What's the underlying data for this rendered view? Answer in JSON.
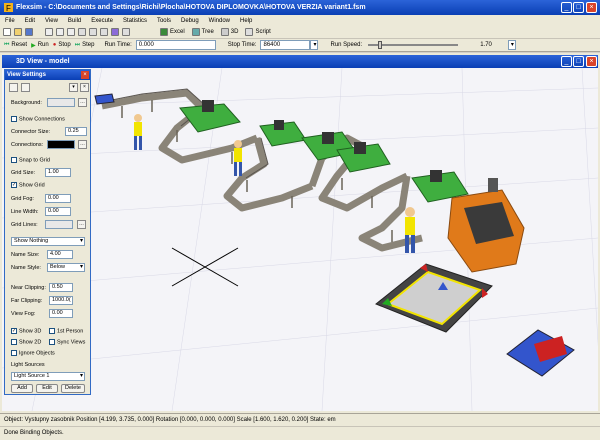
{
  "app": {
    "title": "Flexsim - C:\\Documents and Settings\\Richi\\Plocha\\HOTOVA DIPLOMOVKA\\HOTOVA VERZIA variant1.fsm"
  },
  "menu": [
    "File",
    "Edit",
    "View",
    "Build",
    "Execute",
    "Statistics",
    "Tools",
    "Debug",
    "Window",
    "Help"
  ],
  "toolbar": {
    "excel": "Excel",
    "tree": "Tree",
    "threeD": "3D",
    "script": "Script"
  },
  "runbar": {
    "reset": "Reset",
    "run": "Run",
    "stop": "Stop",
    "step": "Step",
    "run_time_label": "Run Time:",
    "run_time": "0.000",
    "stop_time_label": "Stop Time:",
    "stop_time": "86400",
    "run_speed_label": "Run Speed:",
    "run_speed": "1.70",
    "run_speed_fraction": 0.12
  },
  "view": {
    "title": "3D View - model"
  },
  "panel": {
    "title": "View Settings",
    "background_label": "Background:",
    "show_connections": "Show Connections",
    "connector_size_label": "Connector Size:",
    "connector_size": "0.25",
    "connections_label": "Connections:",
    "snap_to_grid": "Snap to Grid",
    "grid_size_label": "Grid Size:",
    "grid_size": "1.00",
    "show_grid": "Show Grid",
    "grid_fog_label": "Grid Fog:",
    "grid_fog": "0.00",
    "line_width_label": "Line Width:",
    "line_width": "0.00",
    "grid_lines_label": "Grid Lines:",
    "show_nothing": "Show Nothing",
    "name_size_label": "Name Size:",
    "name_size": "4.00",
    "name_style_label": "Name Style:",
    "name_style": "Below",
    "near_clipping_label": "Near Clipping:",
    "near_clipping": "0.50",
    "far_clipping_label": "Far Clipping:",
    "far_clipping": "1000.0(",
    "view_fog_label": "View Fog:",
    "view_fog": "0.00",
    "show_3d": "Show 3D",
    "first_person": "1st Person",
    "show_2d": "Show 2D",
    "sync_views": "Sync Views",
    "ignore_objects": "Ignore Objects",
    "light_sources_label": "Light Sources",
    "light_source": "Light Source 1",
    "add": "Add",
    "edit": "Edit",
    "delete": "Delete",
    "checks": {
      "show_connections": false,
      "snap_to_grid": false,
      "show_grid": true,
      "show_3d": true,
      "first_person": false,
      "show_2d": false,
      "sync_views": false,
      "ignore_objects": false
    }
  },
  "status": {
    "object_line": "Object: Vystupny zasobnik Position [4.199, 3.735, 0.000]  Rotation [0.000, 0.000, 0.000]  Scale [1.600, 1.620, 0.200]  State: em",
    "bottom": "Done Binding Objects."
  },
  "colors": {
    "title_blue": "#0a3fb4",
    "panel_bg": "#ece9d8",
    "canvas_bg": "#f4f4f8",
    "conveyor": "#8a8478",
    "machine_green": "#3fae3f",
    "machine_orange": "#e07a1a",
    "queue_yellow": "#f2e400",
    "sink_blue": "#3355cc",
    "arrow_red": "#cc2222"
  }
}
